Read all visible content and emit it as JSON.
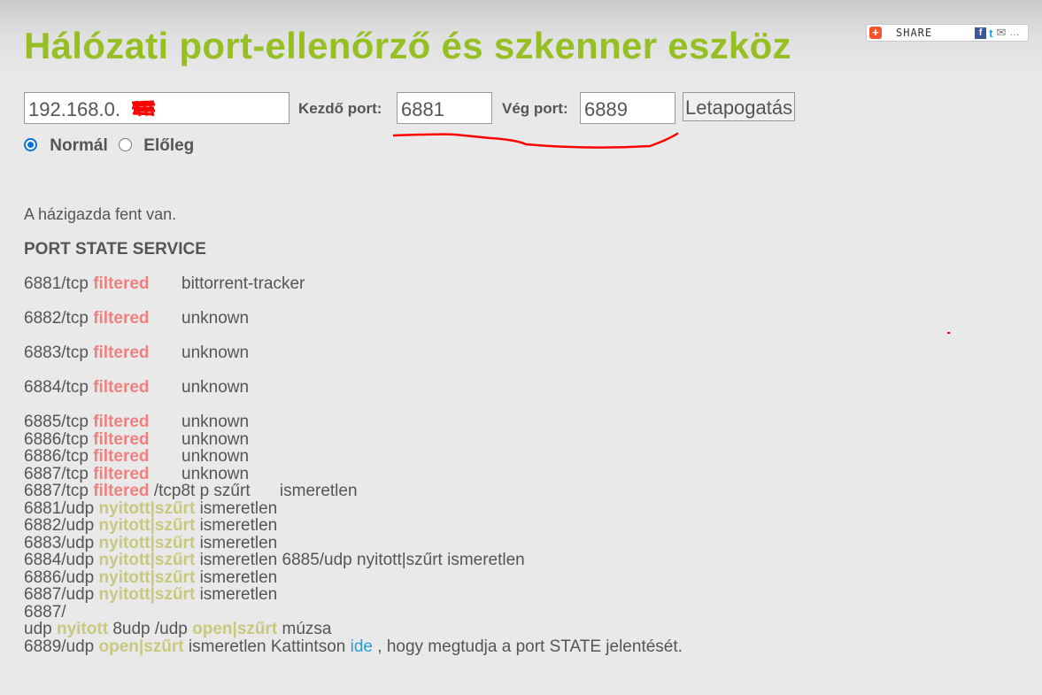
{
  "title": "Hálózati port-ellenőrző és szkenner eszköz",
  "share": {
    "label": "SHARE"
  },
  "form": {
    "host_value": "192.168.0.",
    "start_label": "Kezdő port:",
    "start_value": "6881",
    "end_label": "Vég port:",
    "end_value": "6889",
    "scan_button": "Letapogatás",
    "mode_normal": "Normál",
    "mode_forward": "Előleg",
    "selected_mode": "Normál"
  },
  "result": {
    "status": "A házigazda fent van.",
    "header": "PORT STATE SERVICE",
    "rows": [
      {
        "port": "6881/tcp",
        "state": "filtered",
        "service": "bittorrent-tracker"
      },
      {
        "port": "6882/tcp",
        "state": "filtered",
        "service": "unknown"
      },
      {
        "port": "6883/tcp",
        "state": "filtered",
        "service": "unknown"
      },
      {
        "port": "6884/tcp",
        "state": "filtered",
        "service": "unknown"
      },
      {
        "port": "6885/tcp",
        "state": "filtered",
        "service": "unknown"
      },
      {
        "port": "6886/tcp",
        "state": "filtered",
        "service": "unknown"
      },
      {
        "port": "6886/tcp",
        "state": "filtered",
        "service": "unknown"
      },
      {
        "port": "6887/tcp",
        "state": "filtered",
        "service": "unknown"
      }
    ],
    "mixed_tcp": {
      "port": "6887/tcp",
      "state": "filtered",
      "rest": "/tcp8t p szűrt",
      "service": "ismeretlen"
    },
    "udp_rows": [
      {
        "port": "6881/udp",
        "state": "nyitott|szűrt",
        "service": "ismeretlen",
        "extra": ""
      },
      {
        "port": "6882/udp",
        "state": "nyitott|szűrt",
        "service": "ismeretlen",
        "extra": ""
      },
      {
        "port": "6883/udp",
        "state": "nyitott|szűrt",
        "service": "ismeretlen",
        "extra": ""
      },
      {
        "port": "6884/udp",
        "state": "nyitott|szűrt",
        "service": "ismeretlen",
        "extra": "6885/udp nyitott|szűrt ismeretlen"
      },
      {
        "port": "6886/udp",
        "state": "nyitott|szűrt",
        "service": "ismeretlen",
        "extra": ""
      },
      {
        "port": "6887/udp",
        "state": "nyitott|szűrt",
        "service": "ismeretlen",
        "extra": ""
      }
    ],
    "fragment_a": "6887/",
    "fragment_b": {
      "p1": "udp",
      "s1": "nyitott",
      "p2": "8udp /udp",
      "s2": "open|szűrt",
      "p3": "múzsa"
    },
    "last": {
      "port": "6889/udp",
      "state": "open|szűrt",
      "text_before": "ismeretlen Kattintson",
      "link": "ide",
      "text_after": ", hogy megtudja a port STATE jelentését."
    }
  },
  "colors": {
    "title": "#96bf24",
    "filtered": "#f07f7f",
    "open_filtered": "#c8c87e",
    "link": "#2b9fd9",
    "radio_selected": "#0a72d3",
    "annotation": "#ff0000"
  }
}
